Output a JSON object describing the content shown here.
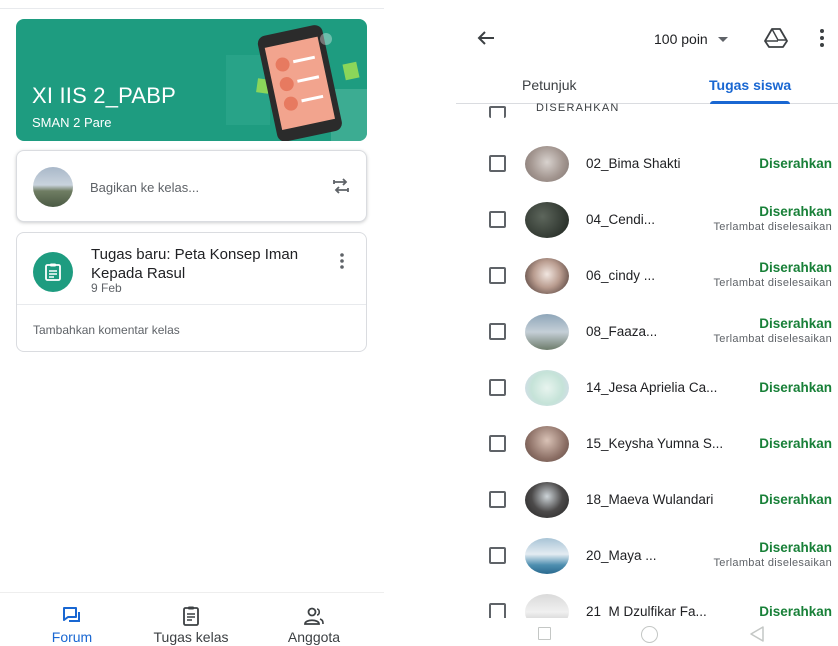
{
  "left": {
    "class_card": {
      "title": "XI IIS 2_PABP",
      "subtitle": "SMAN 2 Pare"
    },
    "share": {
      "placeholder": "Bagikan ke kelas..."
    },
    "post": {
      "title": "Tugas baru: Peta Konsep Iman Kepada Rasul",
      "date": "9 Feb",
      "comment_placeholder": "Tambahkan komentar kelas"
    },
    "bottom_nav": [
      {
        "label": "Forum",
        "icon": "forum-icon",
        "active": true
      },
      {
        "label": "Tugas kelas",
        "icon": "classwork-icon",
        "active": false
      },
      {
        "label": "Anggota",
        "icon": "people-icon",
        "active": false
      }
    ]
  },
  "right": {
    "points": "100 poin",
    "tabs": [
      {
        "label": "Petunjuk",
        "active": false
      },
      {
        "label": "Tugas siswa",
        "active": true
      }
    ],
    "section_header": "DISERAHKAN",
    "students": [
      {
        "name": "02_Bima Shakti",
        "status": "Diserahkan",
        "late": ""
      },
      {
        "name": "04_Cendi...",
        "status": "Diserahkan",
        "late": "Terlambat diselesaikan"
      },
      {
        "name": "06_cindy ...",
        "status": "Diserahkan",
        "late": "Terlambat diselesaikan"
      },
      {
        "name": "08_Faaza...",
        "status": "Diserahkan",
        "late": "Terlambat diselesaikan"
      },
      {
        "name": "14_Jesa Aprielia Ca...",
        "status": "Diserahkan",
        "late": ""
      },
      {
        "name": "15_Keysha Yumna S...",
        "status": "Diserahkan",
        "late": ""
      },
      {
        "name": "18_Maeva Wulandari",
        "status": "Diserahkan",
        "late": ""
      },
      {
        "name": "20_Maya ...",
        "status": "Diserahkan",
        "late": "Terlambat diselesaikan"
      },
      {
        "name": "21_M Dzulfikar Fa...",
        "status": "Diserahkan",
        "late": ""
      }
    ]
  },
  "colors": {
    "accent": "#1967d2",
    "class_theme": "#1e9c80",
    "status_green": "#188038"
  }
}
